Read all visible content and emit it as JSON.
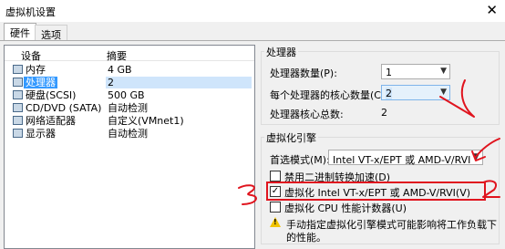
{
  "window": {
    "title": "虚拟机设置",
    "close": "✕"
  },
  "tabs": [
    {
      "label": "硬件"
    },
    {
      "label": "选项"
    }
  ],
  "device_list": {
    "headers": {
      "device": "设备",
      "summary": "摘要"
    },
    "rows": [
      {
        "device": "内存",
        "summary": "4 GB"
      },
      {
        "device": "处理器",
        "summary": "2"
      },
      {
        "device": "硬盘(SCSI)",
        "summary": "500 GB"
      },
      {
        "device": "CD/DVD (SATA)",
        "summary": "自动检测"
      },
      {
        "device": "网络适配器",
        "summary": "自定义(VMnet1)"
      },
      {
        "device": "显示器",
        "summary": "自动检测"
      }
    ],
    "selected": "处理器"
  },
  "processors": {
    "title": "处理器",
    "count_label": "处理器数量(P):",
    "count_value": "1",
    "cores_label": "每个处理器的核心数量(C):",
    "cores_value": "2",
    "total_label": "处理器核心总数:",
    "total_value": "2"
  },
  "virtualization": {
    "title": "虚拟化引擎",
    "mode_label": "首选模式(M):",
    "mode_value": "Intel VT-x/EPT 或 AMD-V/RVI",
    "options": [
      {
        "label": "禁用二进制转换加速(D)",
        "checked": false,
        "mark": ""
      },
      {
        "label": "虚拟化 Intel VT-x/EPT 或 AMD-V/RVI(V)",
        "checked": true,
        "mark": "✓"
      },
      {
        "label": "虚拟化 CPU 性能计数器(U)",
        "checked": false,
        "mark": ""
      }
    ],
    "warning_line1": "手动指定虚拟化引擎模式可能影响将工作负载下",
    "warning_line2": "的性能。"
  }
}
